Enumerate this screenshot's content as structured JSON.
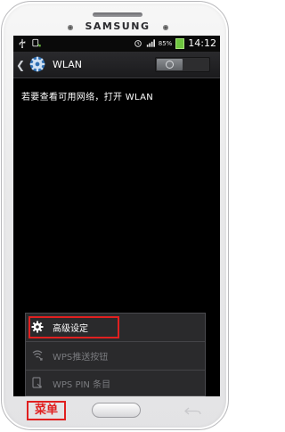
{
  "device": {
    "brand": "SAMSUNG"
  },
  "status_bar": {
    "battery_percent": "85%",
    "time": "14:12",
    "icons": [
      "usb-icon",
      "android-debug-icon",
      "alarm-icon",
      "signal-icon",
      "battery-icon"
    ]
  },
  "action_bar": {
    "title": "WLAN",
    "toggle_state": "off",
    "icons": [
      "back-chevron-icon",
      "settings-gear-icon"
    ]
  },
  "main": {
    "message": "若要查看可用网络，打开 WLAN"
  },
  "menu": {
    "items": [
      {
        "label": "高级设定",
        "icon": "gear-icon",
        "enabled": true
      },
      {
        "label": "WPS推送按钮",
        "icon": "wps-push-icon",
        "enabled": false
      },
      {
        "label": "WPS PIN 条目",
        "icon": "wps-pin-icon",
        "enabled": false
      }
    ]
  },
  "annotation": {
    "menu_key_label": "菜单",
    "highlight_color": "#e02020"
  },
  "colors": {
    "screen_bg": "#000000",
    "menu_bg": "#2a2a2c",
    "battery": "#6ec540"
  }
}
